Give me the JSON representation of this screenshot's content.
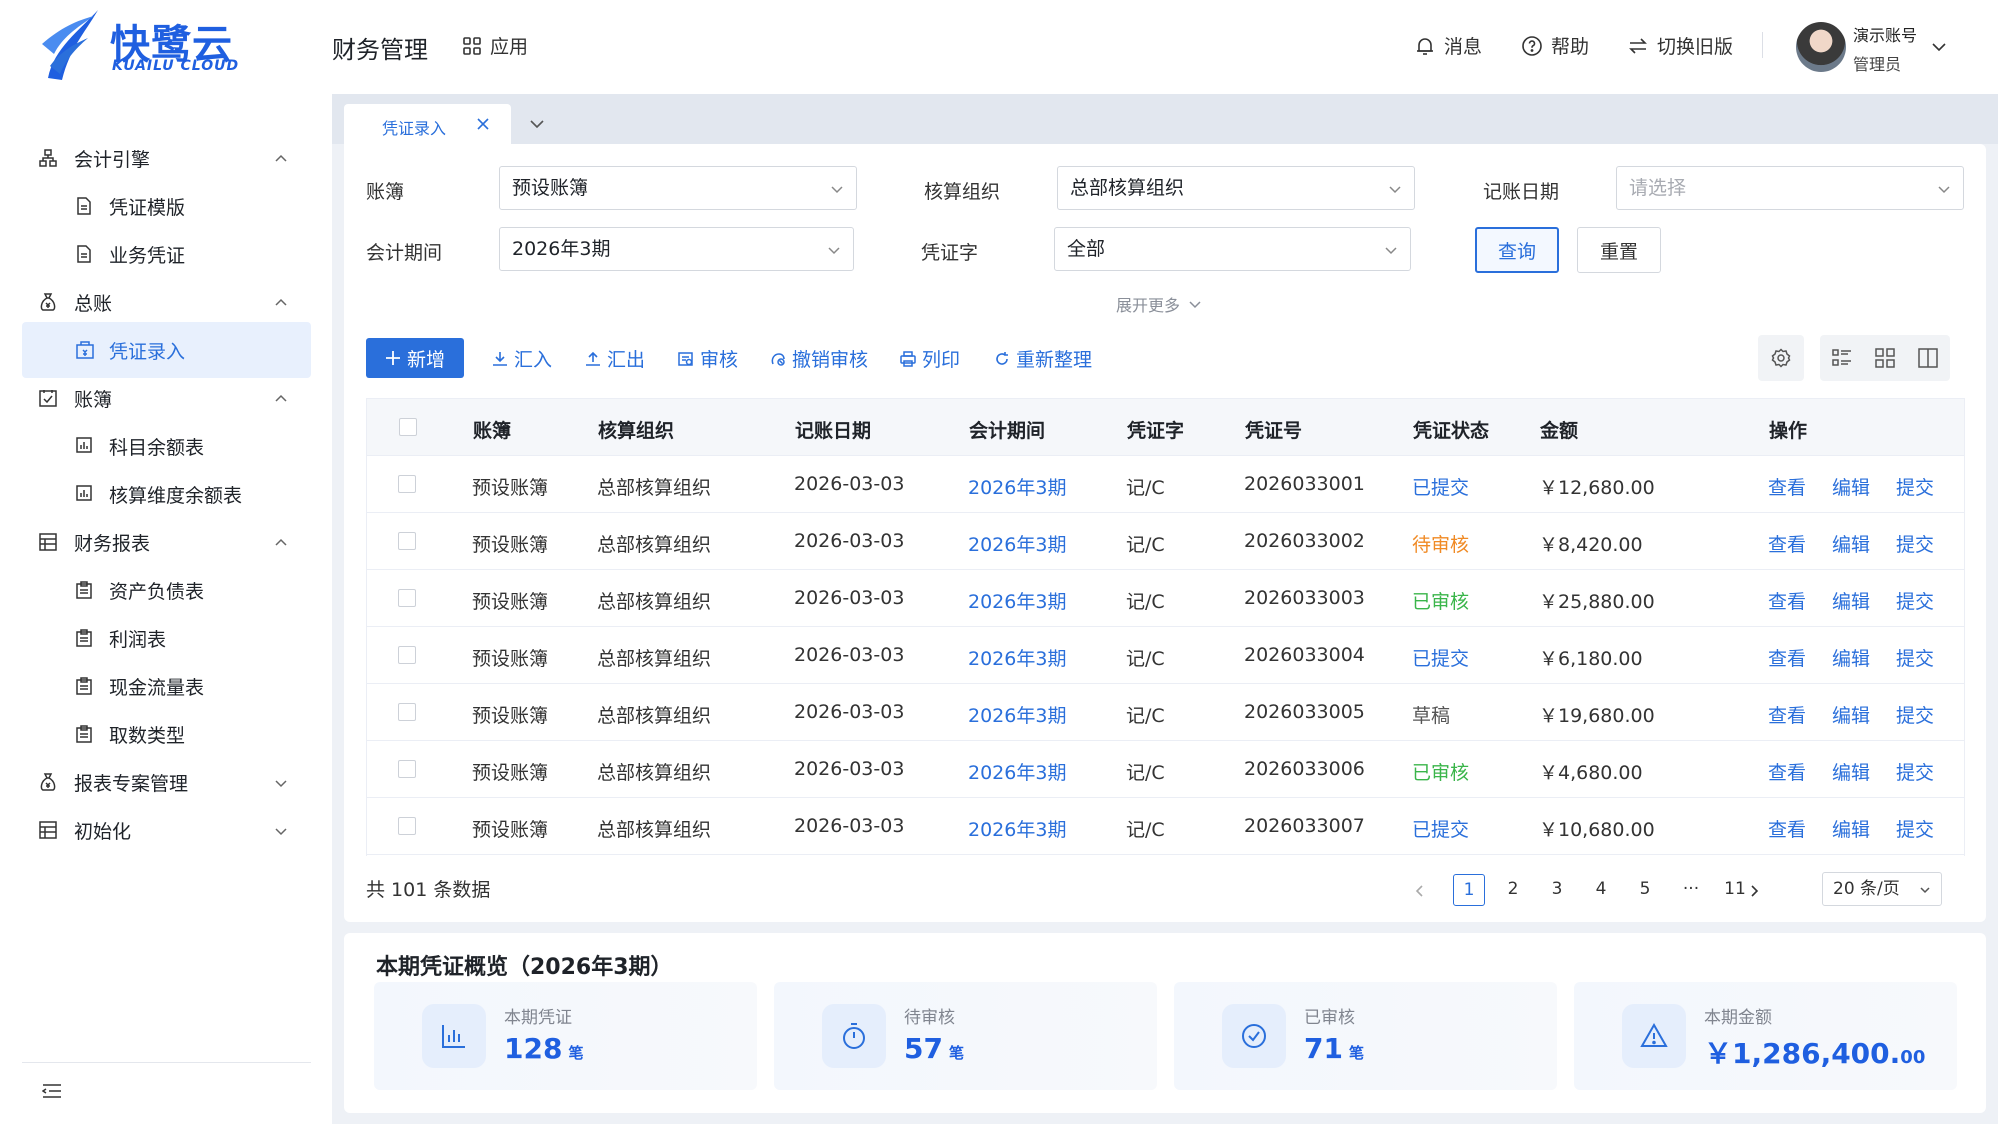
{
  "brand": {
    "name": "快鹭云",
    "sub": "KUAILU CLOUD"
  },
  "header": {
    "title": "财务管理",
    "apps_label": "应用",
    "messages_label": "消息",
    "help_label": "帮助",
    "switch_label": "切换旧版",
    "user_name": "演示账号",
    "user_role": "管理员"
  },
  "sidebar": {
    "items": [
      {
        "label": "会计引擎",
        "icon": "org-icon"
      },
      {
        "label": "凭证模版",
        "icon": "doc-icon"
      },
      {
        "label": "业务凭证",
        "icon": "doc-icon"
      },
      {
        "label": "总账",
        "icon": "money-bag-icon"
      },
      {
        "label": "凭证录入",
        "icon": "voucher-icon"
      },
      {
        "label": "账簿",
        "icon": "ledger-icon"
      },
      {
        "label": "科目余额表",
        "icon": "chart-icon"
      },
      {
        "label": "核算维度余额表",
        "icon": "chart-icon"
      },
      {
        "label": "财务报表",
        "icon": "report-icon"
      },
      {
        "label": "资产负债表",
        "icon": "clipboard-icon"
      },
      {
        "label": "利润表",
        "icon": "clipboard-icon"
      },
      {
        "label": "现金流量表",
        "icon": "clipboard-icon"
      },
      {
        "label": "取数类型",
        "icon": "clipboard-icon"
      },
      {
        "label": "报表专案管理",
        "icon": "money-bag-icon"
      },
      {
        "label": "初始化",
        "icon": "report-icon"
      }
    ]
  },
  "tabs": {
    "active_label": "凭证录入"
  },
  "filters": {
    "ledger_label": "账簿",
    "ledger_value": "预设账簿",
    "org_label": "核算组织",
    "org_value": "总部核算组织",
    "date_label": "记账日期",
    "date_placeholder": "请选择",
    "period_label": "会计期间",
    "period_value": "2026年3期",
    "word_label": "凭证字",
    "word_value": "全部",
    "query_label": "查询",
    "reset_label": "重置",
    "expand_label": "展开更多"
  },
  "toolbar": {
    "add_label": "新增",
    "import_label": "汇入",
    "export_label": "汇出",
    "audit_label": "审核",
    "unaudit_label": "撤销审核",
    "print_label": "列印",
    "reorder_label": "重新整理"
  },
  "table": {
    "columns": [
      "账簿",
      "核算组织",
      "记账日期",
      "会计期间",
      "凭证字",
      "凭证号",
      "凭证状态",
      "金额",
      "操作"
    ],
    "rows": [
      {
        "ledger": "预设账簿",
        "org": "总部核算组织",
        "date": "2026-03-03",
        "period": "2026年3期",
        "word": "记/C",
        "no": "2026033001",
        "status": "已提交",
        "amount": "￥12,680.00"
      },
      {
        "ledger": "预设账簿",
        "org": "总部核算组织",
        "date": "2026-03-03",
        "period": "2026年3期",
        "word": "记/C",
        "no": "2026033002",
        "status": "待审核",
        "amount": "￥8,420.00"
      },
      {
        "ledger": "预设账簿",
        "org": "总部核算组织",
        "date": "2026-03-03",
        "period": "2026年3期",
        "word": "记/C",
        "no": "2026033003",
        "status": "已审核",
        "amount": "￥25,880.00"
      },
      {
        "ledger": "预设账簿",
        "org": "总部核算组织",
        "date": "2026-03-03",
        "period": "2026年3期",
        "word": "记/C",
        "no": "2026033004",
        "status": "已提交",
        "amount": "￥6,180.00"
      },
      {
        "ledger": "预设账簿",
        "org": "总部核算组织",
        "date": "2026-03-03",
        "period": "2026年3期",
        "word": "记/C",
        "no": "2026033005",
        "status": "草稿",
        "amount": "￥19,680.00"
      },
      {
        "ledger": "预设账簿",
        "org": "总部核算组织",
        "date": "2026-03-03",
        "period": "2026年3期",
        "word": "记/C",
        "no": "2026033006",
        "status": "已审核",
        "amount": "￥4,680.00"
      },
      {
        "ledger": "预设账簿",
        "org": "总部核算组织",
        "date": "2026-03-03",
        "period": "2026年3期",
        "word": "记/C",
        "no": "2026033007",
        "status": "已提交",
        "amount": "￥10,680.00"
      }
    ],
    "ops": {
      "view": "查看",
      "edit": "编辑",
      "submit": "提交"
    }
  },
  "status_colors": {
    "已提交": "#2a6fdb",
    "待审核": "#f08a24",
    "已审核": "#3ab54a",
    "草稿": "#555555"
  },
  "pagination": {
    "total_label": "共 101 条数据",
    "pages": [
      "1",
      "2",
      "3",
      "4",
      "5",
      "···",
      "11"
    ],
    "current": "1",
    "page_size": "20 条/页"
  },
  "summary": {
    "title": "本期凭证概览（2026年3期）",
    "cards": [
      {
        "label": "本期凭证",
        "value": "128",
        "unit": "笔",
        "icon": "bar-chart-icon"
      },
      {
        "label": "待审核",
        "value": "57",
        "unit": "笔",
        "icon": "stopwatch-icon"
      },
      {
        "label": "已审核",
        "value": "71",
        "unit": "笔",
        "icon": "check-circle-icon"
      },
      {
        "label": "本期金额",
        "value": "￥1,286,400.",
        "cents": "00",
        "icon": "warning-icon"
      }
    ]
  },
  "colors": {
    "primary": "#2a6fdb",
    "brand": "#1f5fe0"
  }
}
